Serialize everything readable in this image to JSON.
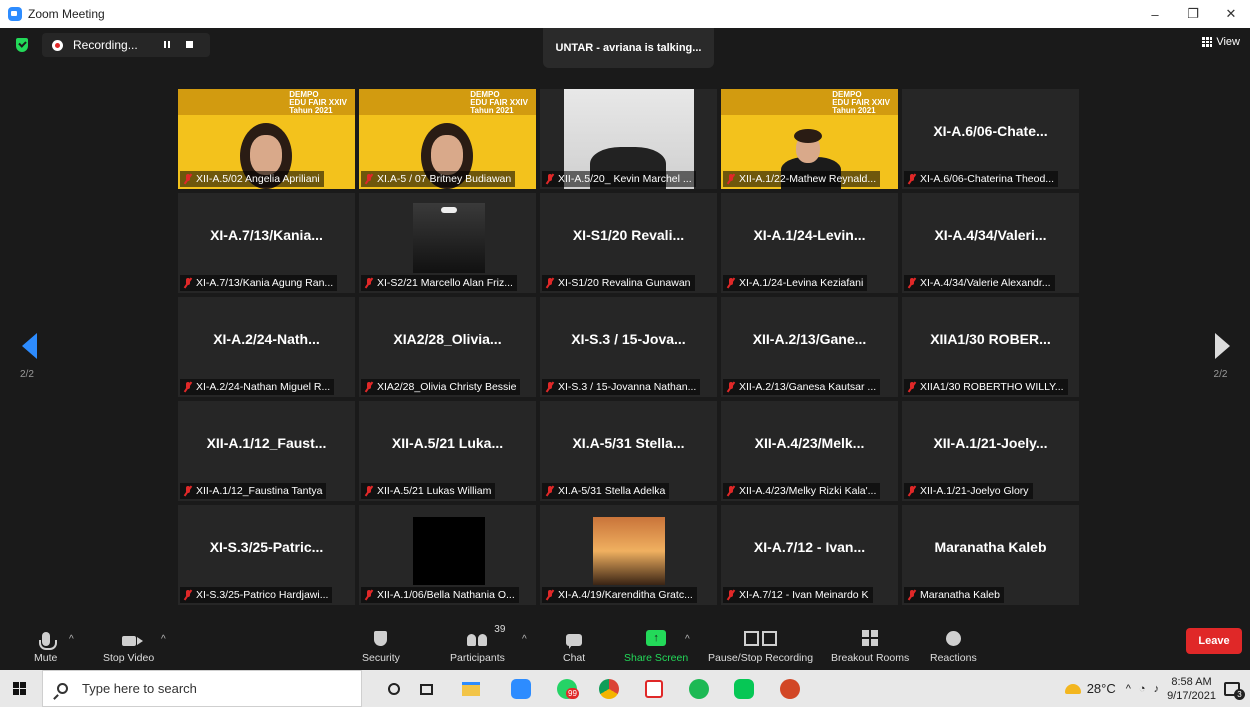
{
  "window": {
    "title": "Zoom Meeting",
    "controls": {
      "minimize": "–",
      "maximize": "❐",
      "close": "✕"
    }
  },
  "topbar": {
    "recording_label": "Recording...",
    "talking": "UNTAR - avriana is talking...",
    "view_label": "View"
  },
  "navigation": {
    "page_left": "2/2",
    "page_right": "2/2"
  },
  "banner": {
    "line1": "DEMPO",
    "line2": "EDU FAIR XXIV",
    "line3": "Tahun 2021"
  },
  "tiles": [
    {
      "center": "",
      "name": "XII-A.5/02 Angelia Apriliani"
    },
    {
      "center": "",
      "name": "XI.A-5 / 07 Britney Budiawan"
    },
    {
      "center": "",
      "name": "XII-A.5/20_ Kevin Marchel ..."
    },
    {
      "center": "",
      "name": "XII-A.1/22-Mathew Reynald..."
    },
    {
      "center": "XI-A.6/06-Chate...",
      "name": "XI-A.6/06-Chaterina Theod..."
    },
    {
      "center": "XI-A.7/13/Kania...",
      "name": "XI-A.7/13/Kania Agung Ran..."
    },
    {
      "center": "",
      "name": "XI-S2/21 Marcello Alan Friz..."
    },
    {
      "center": "XI-S1/20 Revali...",
      "name": "XI-S1/20 Revalina Gunawan"
    },
    {
      "center": "XI-A.1/24-Levin...",
      "name": "XI-A.1/24-Levina Keziafani"
    },
    {
      "center": "XI-A.4/34/Valeri...",
      "name": "XI-A.4/34/Valerie Alexandr..."
    },
    {
      "center": "XI-A.2/24-Nath...",
      "name": "XI-A.2/24-Nathan Miguel R..."
    },
    {
      "center": "XIA2/28_Olivia...",
      "name": "XIA2/28_Olivia Christy Bessie"
    },
    {
      "center": "XI-S.3 / 15-Jova...",
      "name": "XI-S.3 / 15-Jovanna Nathan..."
    },
    {
      "center": "XII-A.2/13/Gane...",
      "name": "XII-A.2/13/Ganesa Kautsar ..."
    },
    {
      "center": "XIIA1/30 ROBER...",
      "name": "XIIA1/30 ROBERTHO WILLY..."
    },
    {
      "center": "XII-A.1/12_Faust...",
      "name": "XII-A.1/12_Faustina Tantya"
    },
    {
      "center": "XII-A.5/21 Luka...",
      "name": "XII-A.5/21 Lukas William"
    },
    {
      "center": "XI.A-5/31 Stella...",
      "name": "XI.A-5/31 Stella Adelka"
    },
    {
      "center": "XII-A.4/23/Melk...",
      "name": "XII-A.4/23/Melky Rizki Kala'..."
    },
    {
      "center": "XII-A.1/21-Joely...",
      "name": "XII-A.1/21-Joelyo Glory"
    },
    {
      "center": "XI-S.3/25-Patric...",
      "name": "XI-S.3/25-Patrico Hardjawi..."
    },
    {
      "center": "",
      "name": "XII-A.1/06/Bella Nathania O..."
    },
    {
      "center": "",
      "name": "XI-A.4/19/Karenditha Gratc..."
    },
    {
      "center": "XI-A.7/12 - Ivan...",
      "name": "XI-A.7/12 - Ivan Meinardo K"
    },
    {
      "center": "Maranatha Kaleb",
      "name": "Maranatha Kaleb"
    }
  ],
  "toolbar": {
    "mute": "Mute",
    "stop_video": "Stop Video",
    "security": "Security",
    "participants": "Participants",
    "participant_count": "39",
    "chat": "Chat",
    "share_screen": "Share Screen",
    "pause_stop_recording": "Pause/Stop Recording",
    "breakout_rooms": "Breakout Rooms",
    "reactions": "Reactions",
    "leave": "Leave"
  },
  "taskbar": {
    "search_placeholder": "Type here to search",
    "whatsapp_badge": "99",
    "temperature": "28°C",
    "time": "8:58 AM",
    "date": "9/17/2021",
    "notification_count": "3"
  },
  "colors": {
    "accent": "#2d8cff",
    "leave": "#e02828",
    "share": "#23d959",
    "banner": "#f3c21c"
  }
}
